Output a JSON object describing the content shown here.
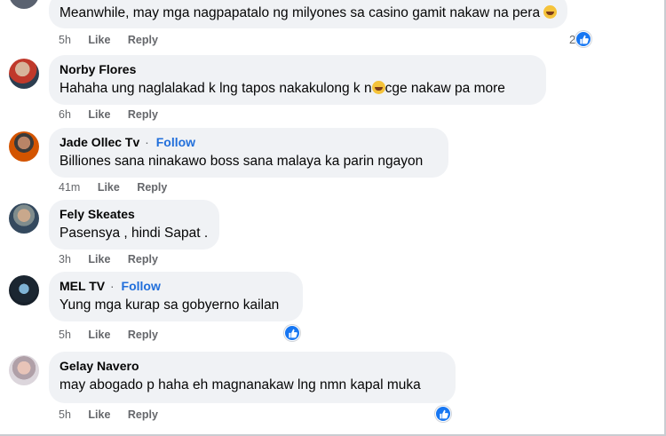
{
  "comments": [
    {
      "author": "",
      "follow": "",
      "text": "Meanwhile, may mga nagpapatalo ng milyones sa casino gamit nakaw na pera",
      "emoji_after": true,
      "time": "5h",
      "like": "Like",
      "reply": "Reply",
      "reaction_count": "2",
      "has_reaction": true
    },
    {
      "author": "Norby Flores",
      "follow": "",
      "text_before": "Hahaha ung naglalakad k lng tapos nakakulong k n",
      "text_after": "cge nakaw pa more",
      "time": "6h",
      "like": "Like",
      "reply": "Reply",
      "has_reaction": false
    },
    {
      "author": "Jade Ollec Tv",
      "follow": "Follow",
      "text": "Billiones sana ninakawo boss sana malaya ka parin ngayon",
      "time": "41m",
      "like": "Like",
      "reply": "Reply",
      "has_reaction": false
    },
    {
      "author": "Fely Skeates",
      "follow": "",
      "text": "Pasensya , hindi Sapat .",
      "time": "3h",
      "like": "Like",
      "reply": "Reply",
      "has_reaction": false
    },
    {
      "author": "MEL TV",
      "follow": "Follow",
      "text": "Yung mga kurap sa gobyerno kailan",
      "time": "5h",
      "like": "Like",
      "reply": "Reply",
      "has_reaction": true
    },
    {
      "author": "Gelay Navero",
      "follow": "",
      "text": "may abogado p haha eh magnanakaw lng nmn kapal muka",
      "time": "5h",
      "like": "Like",
      "reply": "Reply",
      "has_reaction": true
    }
  ],
  "separator": "·",
  "colors": {
    "bubble": "#f0f2f5",
    "link": "#216fdb",
    "meta": "#65676b",
    "like_blue": "#1877f2"
  },
  "icons": {
    "reaction": "thumbs-up-icon",
    "emoji": "rolling-laughing-emoji-icon"
  }
}
